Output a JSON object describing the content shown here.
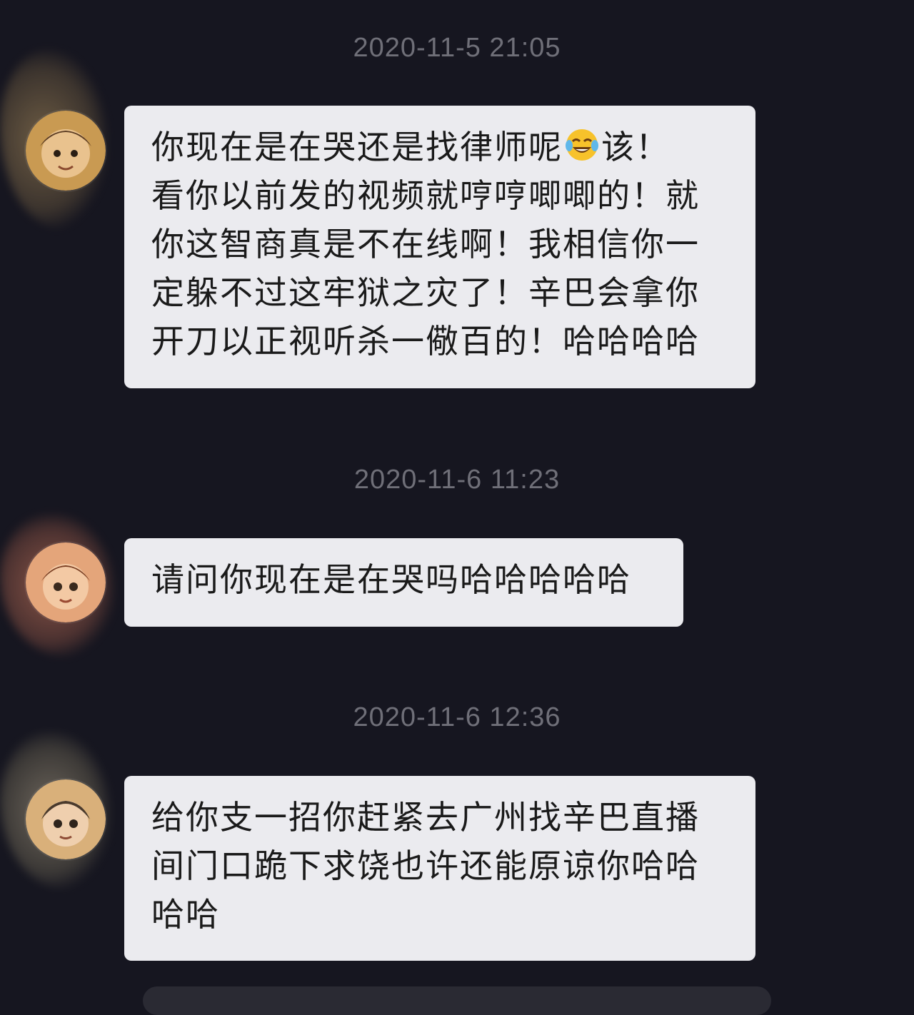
{
  "messages": [
    {
      "timestamp": "2020-11-5 21:05",
      "avatar_icon": "cartoon-kid-avatar-icon",
      "lines": [
        "你现在是在哭还是找律师呢",
        "看你以前发的视频就哼哼唧唧的！就",
        "你这智商真是不在线啊！我相信你一",
        "定躲不过这牢狱之灾了！辛巴会拿你",
        "开刀以正视听杀一儆百的！哈哈哈哈"
      ],
      "line1_emoji": "tears-of-joy-emoji-icon",
      "line1_suffix": "该！"
    },
    {
      "timestamp": "2020-11-6 11:23",
      "avatar_icon": "cartoon-kid-avatar-icon",
      "lines": [
        "请问你现在是在哭吗哈哈哈哈哈"
      ]
    },
    {
      "timestamp": "2020-11-6 12:36",
      "avatar_icon": "cartoon-kid-avatar-icon",
      "lines": [
        "给你支一招你赶紧去广州找辛巴直播",
        "间门口跪下求饶也许还能原谅你哈哈",
        "哈哈"
      ]
    }
  ],
  "colors": {
    "background": "#161620",
    "bubble": "#ebebef",
    "timestamp_text": "#6f6f78",
    "message_text": "#1a1a1a"
  }
}
